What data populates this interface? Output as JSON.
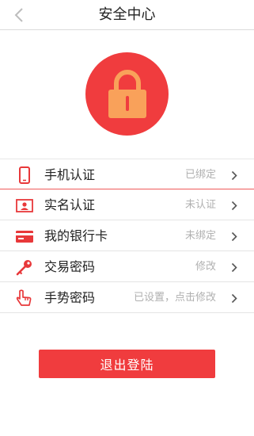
{
  "header": {
    "title": "安全中心",
    "back_icon": "chevron-left-icon"
  },
  "badge": {
    "icon": "padlock-icon",
    "background": "#f03c3e",
    "icon_color": "#f9a15a"
  },
  "menu": {
    "items": [
      {
        "label": "手机认证",
        "status": "已绑定",
        "icon": "mobile-phone-icon"
      },
      {
        "label": "实名认证",
        "status": "未认证",
        "icon": "id-card-icon"
      },
      {
        "label": "我的银行卡",
        "status": "未绑定",
        "icon": "bank-card-icon"
      },
      {
        "label": "交易密码",
        "status": "修改",
        "icon": "key-icon"
      },
      {
        "label": "手势密码",
        "status": "已设置，点击修改",
        "icon": "gesture-hand-icon"
      }
    ]
  },
  "logout": {
    "label": "退出登陆"
  },
  "colors": {
    "accent": "#f03c3e",
    "status_text": "#b0b0b0",
    "icon_red": "#e8383a"
  }
}
